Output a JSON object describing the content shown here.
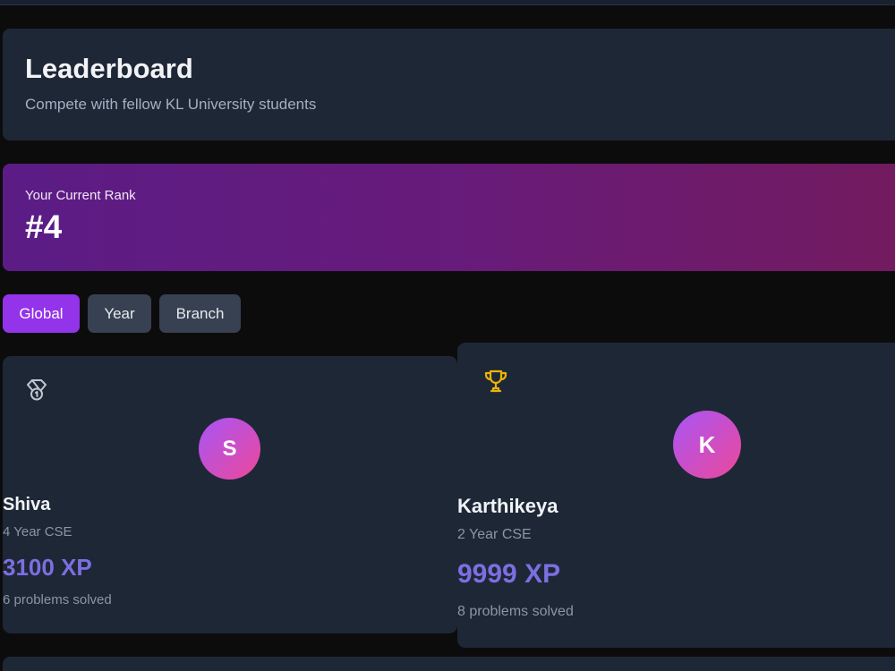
{
  "header": {
    "title": "Leaderboard",
    "subtitle": "Compete with fellow KL University students"
  },
  "current_rank": {
    "label": "Your Current Rank",
    "value": "#4"
  },
  "filters": [
    {
      "label": "Global",
      "active": true
    },
    {
      "label": "Year",
      "active": false
    },
    {
      "label": "Branch",
      "active": false
    }
  ],
  "podium": [
    {
      "place_icon": "medal-icon",
      "initial": "S",
      "name": "Shiva",
      "meta": "4 Year CSE",
      "xp": "3100 XP",
      "solved": "6 problems solved"
    },
    {
      "place_icon": "trophy-icon",
      "initial": "K",
      "name": "Karthikeya",
      "meta": "2 Year CSE",
      "xp": "9999 XP",
      "solved": "8 problems solved"
    }
  ],
  "colors": {
    "background": "#0c0c0d",
    "card": "#1e2736",
    "accent_purple": "#9333ea",
    "xp_text": "#7c6fe0",
    "trophy_gold": "#eab308",
    "medal_gray": "#c0c6d0"
  }
}
